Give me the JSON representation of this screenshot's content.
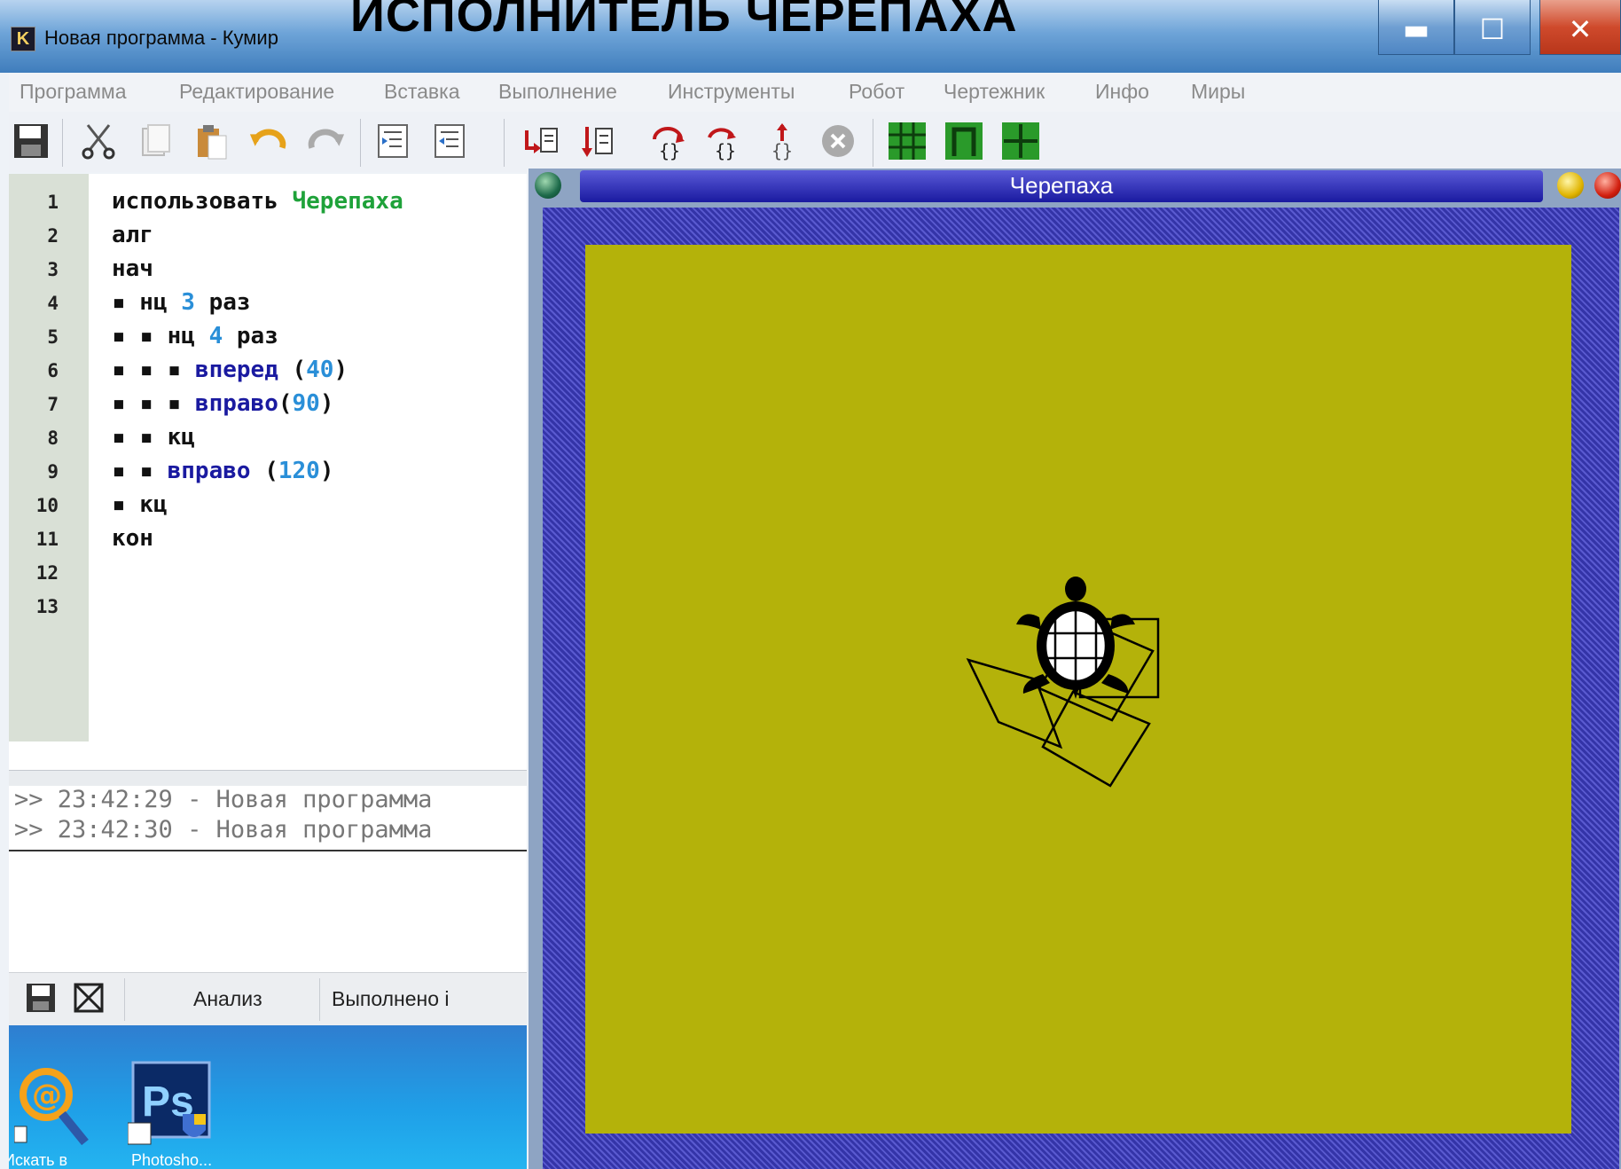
{
  "window": {
    "app_icon_letter": "K",
    "title": "Новая программа - Кумир",
    "overlay_heading": "ИСПОЛНИТЕЛЬ ЧЕРЕПАХА",
    "minimize_glyph": "▬",
    "maximize_glyph": "☐",
    "close_glyph": "✕"
  },
  "menu": [
    "Программа",
    "Редактирование",
    "Вставка",
    "Выполнение",
    "Инструменты",
    "Робот",
    "Чертежник",
    "Инфо",
    "Миры"
  ],
  "toolbar_icons": [
    "save-icon",
    "cut-icon",
    "copy-icon",
    "paste-icon",
    "undo-icon",
    "redo-icon",
    "indent-icon",
    "unindent-icon",
    "run-icon",
    "step-run-icon",
    "step-into-icon",
    "step-out-icon",
    "step-over-icon",
    "stop-icon",
    "robot-world-icon",
    "drawer-world-icon",
    "turtle-world-icon"
  ],
  "editor": {
    "line_numbers": [
      "1",
      "2",
      "3",
      "4",
      "5",
      "6",
      "7",
      "8",
      "9",
      "10",
      "11",
      "12",
      "13"
    ],
    "lines": [
      [
        {
          "t": "использовать ",
          "c": ""
        },
        {
          "t": "Черепаха",
          "c": "kw-green"
        }
      ],
      [
        {
          "t": "алг",
          "c": ""
        }
      ],
      [
        {
          "t": "нач",
          "c": ""
        }
      ],
      [
        {
          "t": "▪ нц ",
          "c": ""
        },
        {
          "t": "3",
          "c": "num"
        },
        {
          "t": " раз",
          "c": ""
        }
      ],
      [
        {
          "t": "▪ ▪ нц ",
          "c": ""
        },
        {
          "t": "4",
          "c": "num"
        },
        {
          "t": " раз",
          "c": ""
        }
      ],
      [
        {
          "t": "▪ ▪ ▪ ",
          "c": ""
        },
        {
          "t": "вперед",
          "c": "kw-blue"
        },
        {
          "t": " (",
          "c": ""
        },
        {
          "t": "40",
          "c": "num"
        },
        {
          "t": ")",
          "c": ""
        }
      ],
      [
        {
          "t": "▪ ▪ ▪ ",
          "c": ""
        },
        {
          "t": "вправо",
          "c": "kw-blue"
        },
        {
          "t": "(",
          "c": ""
        },
        {
          "t": "90",
          "c": "num"
        },
        {
          "t": ")",
          "c": ""
        }
      ],
      [
        {
          "t": "▪ ▪ кц",
          "c": ""
        }
      ],
      [
        {
          "t": "▪ ▪ ",
          "c": ""
        },
        {
          "t": "вправо",
          "c": "kw-blue"
        },
        {
          "t": " (",
          "c": ""
        },
        {
          "t": "120",
          "c": "num"
        },
        {
          "t": ")",
          "c": ""
        }
      ],
      [
        {
          "t": "▪ кц",
          "c": ""
        }
      ],
      [
        {
          "t": "кон",
          "c": ""
        }
      ],
      [],
      []
    ]
  },
  "console": {
    "lines": [
      ">> 23:42:29 - Новая программа",
      ">> 23:42:30 - Новая программа"
    ]
  },
  "statusbar": {
    "tab_analysis": "Анализ",
    "tab_done": "Выполнено і"
  },
  "desktop": {
    "icon1_label": "Искать в",
    "icon2_label": "Photosho...",
    "icon2_badge": "Ps"
  },
  "turtle_window": {
    "title": "Черепаха"
  },
  "colors": {
    "arena": "#b4b20a",
    "title_bar": "#1a1aa0",
    "keyword_green": "#1fa23a",
    "keyword_blue": "#1a1aa0",
    "number": "#2a8fd8"
  }
}
